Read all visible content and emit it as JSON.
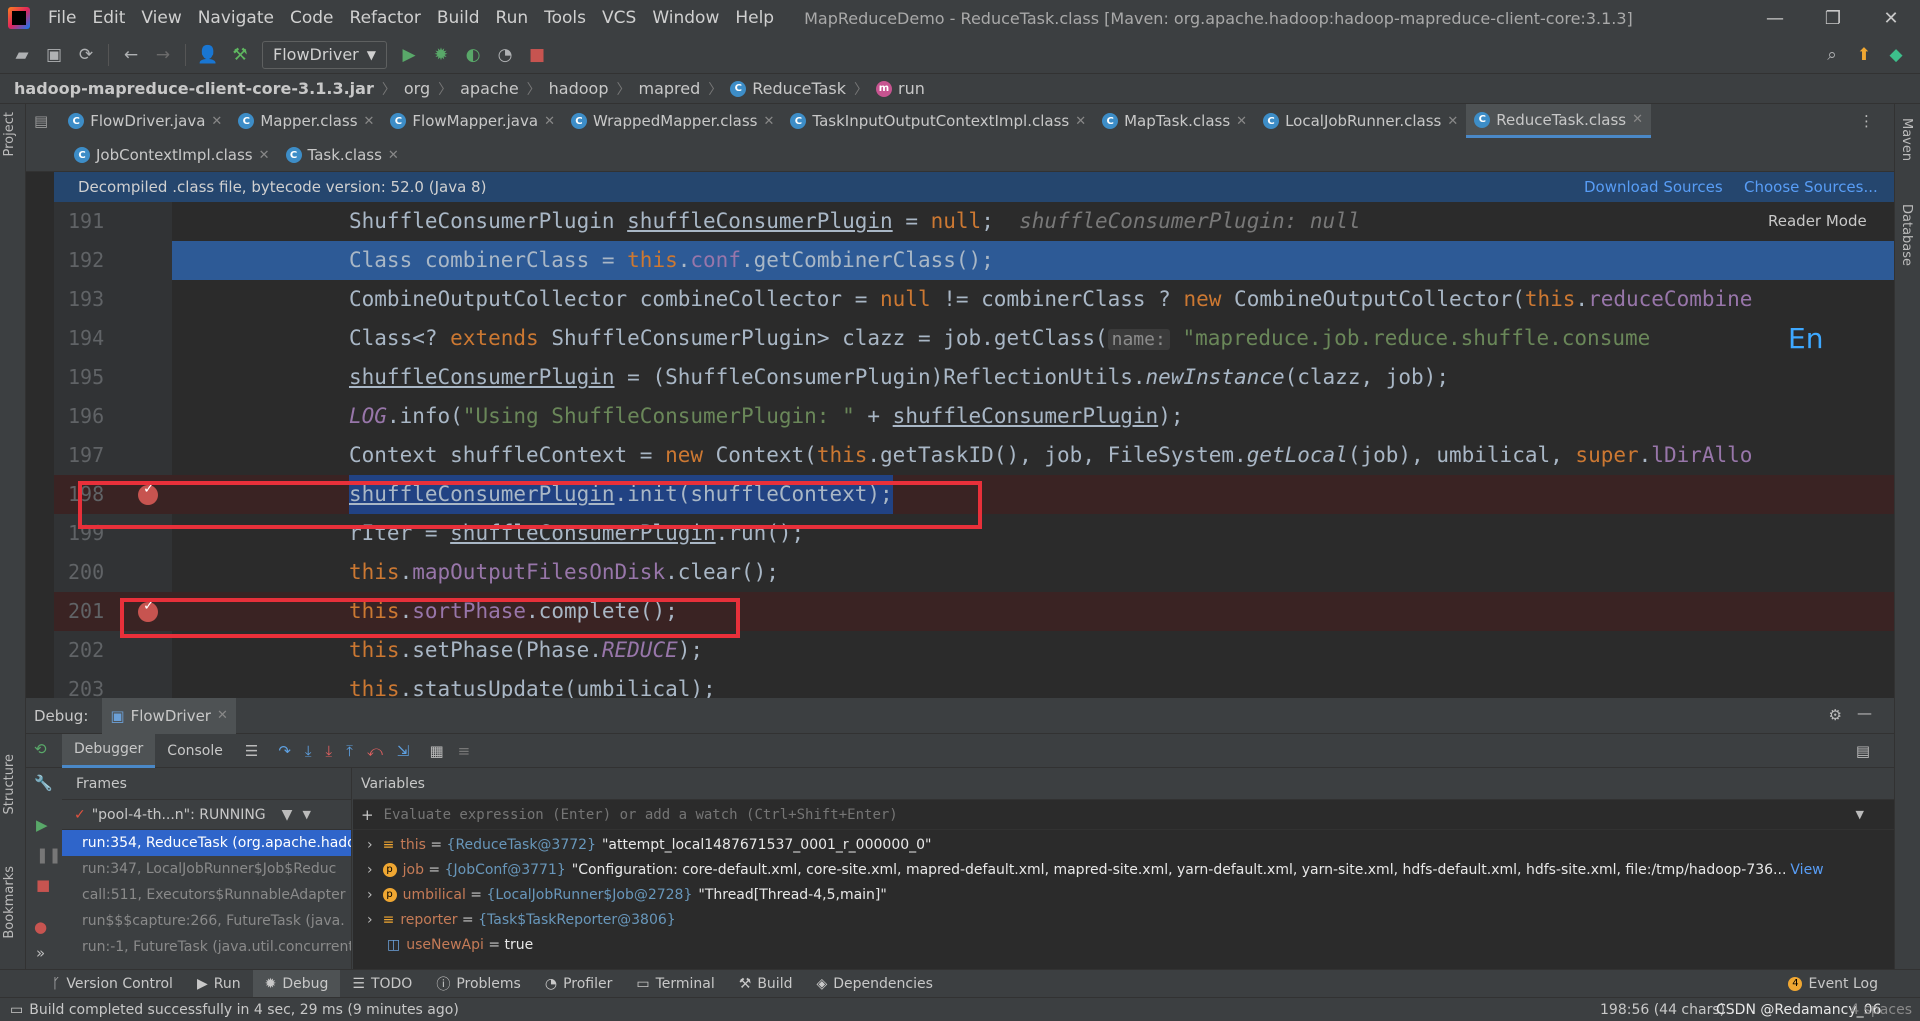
{
  "menu": [
    "File",
    "Edit",
    "View",
    "Navigate",
    "Code",
    "Refactor",
    "Build",
    "Run",
    "Tools",
    "VCS",
    "Window",
    "Help"
  ],
  "window_title": "MapReduceDemo - ReduceTask.class [Maven: org.apache.hadoop:hadoop-mapreduce-client-core:3.1.3]",
  "toolbar": {
    "run_config": "FlowDriver"
  },
  "breadcrumb": [
    "hadoop-mapreduce-client-core-3.1.3.jar",
    "org",
    "apache",
    "hadoop",
    "mapred",
    "ReduceTask",
    "run"
  ],
  "tabs_row1": [
    "FlowDriver.java",
    "Mapper.class",
    "FlowMapper.java",
    "WrappedMapper.class",
    "TaskInputOutputContextImpl.class",
    "MapTask.class",
    "LocalJobRunner.class",
    "ReduceTask.class"
  ],
  "tabs_row2": [
    "JobContextImpl.class",
    "Task.class"
  ],
  "banner": {
    "text": "Decompiled .class file, bytecode version: 52.0 (Java 8)",
    "download": "Download Sources",
    "choose": "Choose Sources..."
  },
  "reader_mode": "Reader Mode",
  "line_numbers": [
    "191",
    "192",
    "193",
    "194",
    "195",
    "196",
    "197",
    "198",
    "199",
    "200",
    "201",
    "202",
    "203"
  ],
  "debug": {
    "label": "Debug:",
    "config": "FlowDriver",
    "subtabs": [
      "Debugger",
      "Console"
    ],
    "frames_title": "Frames",
    "variables_title": "Variables",
    "thread": "\"pool-4-th...n\": RUNNING",
    "watch_placeholder": "Evaluate expression (Enter) or add a watch (Ctrl+Shift+Enter)",
    "frames": [
      "run:354, ReduceTask (org.apache.hadoop",
      "run:347, LocalJobRunner$Job$Reduc",
      "call:511, Executors$RunnableAdapter",
      "run$$$capture:266, FutureTask (java.",
      "run:-1, FutureTask (java.util.concurrent"
    ],
    "variables": [
      {
        "name": "this",
        "ref": "{ReduceTask@3772}",
        "value": "\"attempt_local1487671537_0001_r_000000_0\""
      },
      {
        "name": "job",
        "ref": "{JobConf@3771}",
        "value": "\"Configuration: core-default.xml, core-site.xml, mapred-default.xml, mapred-site.xml, yarn-default.xml, yarn-site.xml, hdfs-default.xml, hdfs-site.xml, file:/tmp/hadoop-736...",
        "view": "View"
      },
      {
        "name": "umbilical",
        "ref": "{LocalJobRunner$Job@2728}",
        "value": "\"Thread[Thread-4,5,main]\""
      },
      {
        "name": "reporter",
        "ref": "{Task$TaskReporter@3806}",
        "value": ""
      },
      {
        "name": "useNewApi",
        "ref": "true",
        "value": ""
      }
    ]
  },
  "bottom_tabs": [
    "Version Control",
    "Run",
    "Debug",
    "TODO",
    "Problems",
    "Profiler",
    "Terminal",
    "Build",
    "Dependencies"
  ],
  "event_log": "Event Log",
  "status": {
    "message": "Build completed successfully in 4 sec, 29 ms (9 minutes ago)",
    "position": "198:56 (44 chars)",
    "watermark": "CSDN @Redamancy_06",
    "indent": "4 spaces"
  },
  "side_labels": {
    "project": "Project",
    "structure": "Structure",
    "bookmarks": "Bookmarks",
    "maven": "Maven",
    "database": "Database"
  },
  "ime": "En"
}
